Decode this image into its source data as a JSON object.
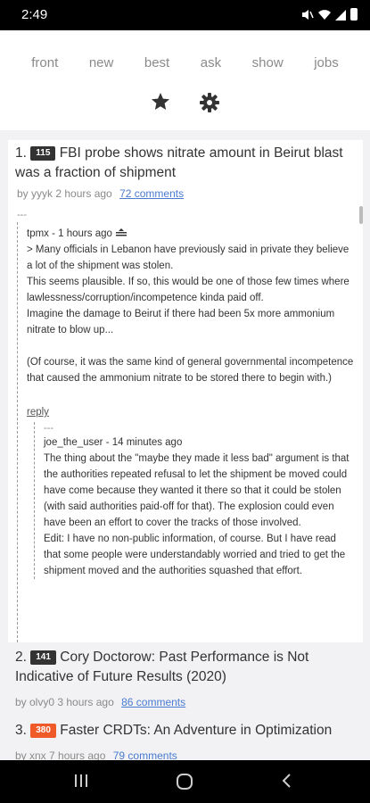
{
  "status": {
    "time": "2:49"
  },
  "nav": {
    "items": [
      "front",
      "new",
      "best",
      "ask",
      "show",
      "jobs"
    ]
  },
  "stories": [
    {
      "rank": "1.",
      "points": "115",
      "title": "FBI probe shows nitrate amount in Beirut blast was a fraction of shipment",
      "by": "by yyyk 2 hours ago",
      "comments": "72 comments",
      "badge_color": "#333333"
    },
    {
      "rank": "2.",
      "points": "141",
      "title": "Cory Doctorow: Past Performance is Not Indicative of Future Results (2020)",
      "by": "by olvy0 3 hours ago",
      "comments": "86 comments",
      "badge_color": "#333333"
    },
    {
      "rank": "3.",
      "points": "380",
      "title": "Faster CRDTs: An Adventure in Optimization",
      "by": "by xnx 7 hours ago",
      "comments": "79 comments",
      "badge_color": "#f05a28"
    }
  ],
  "thread": {
    "separator": "---",
    "comment1": {
      "author": "tpmx - 1 hours ago",
      "p1": "> Many officials in Lebanon have previously said in private they believe a lot of the shipment was stolen.",
      "p2": "This seems plausible. If so, this would be one of those few times where lawlessness/corruption/incompetence kinda paid off.",
      "p3": "Imagine the damage to Beirut if there had been 5x more ammonium nitrate to blow up...",
      "p4": "(Of course, it was the same kind of general governmental incompetence that caused the ammonium nitrate to be stored there to begin with.)",
      "reply": "reply"
    },
    "comment2": {
      "author": "joe_the_user - 14 minutes ago",
      "p1": "The thing about the \"maybe they made it less bad\" argument is that the authorities repeated refusal to let the shipment be moved could have come because they wanted it there so that it could be stolen (with said authorities paid-off for that). The explosion could even have been an effort to cover the tracks of those involved.",
      "p2": "Edit: I have no non-public information, of course. But I have read that some people were understandably worried and tried to get the shipment moved and the authorities squashed that effort."
    }
  }
}
